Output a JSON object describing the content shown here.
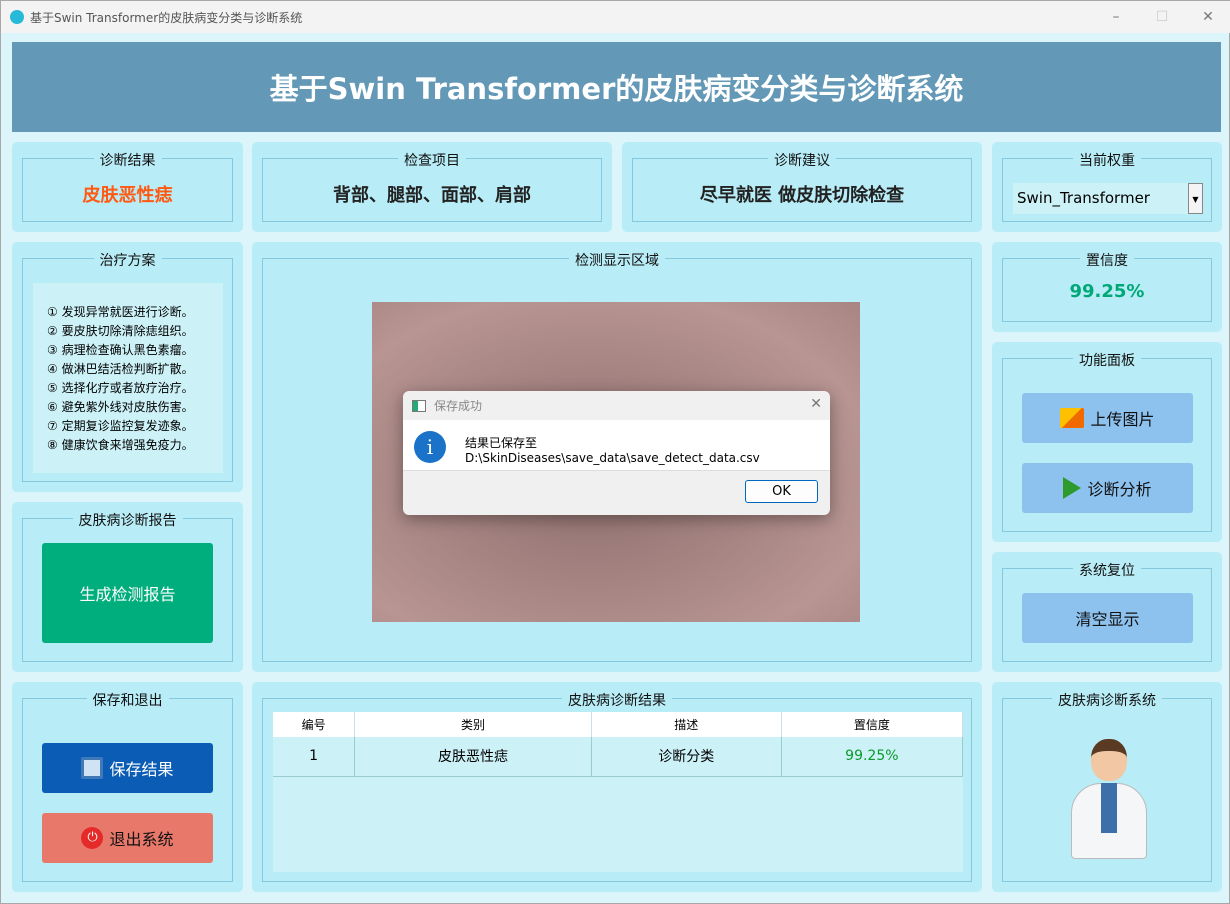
{
  "window": {
    "title": "基于Swin Transformer的皮肤病变分类与诊断系统",
    "minimize": "–",
    "maximize": "☐",
    "close": "✕"
  },
  "banner": "基于Swin Transformer的皮肤病变分类与诊断系统",
  "result": {
    "title": "诊断结果",
    "value": "皮肤恶性痣",
    "color": "#ff5a14"
  },
  "items": {
    "title": "检查项目",
    "value": "背部、腿部、面部、肩部"
  },
  "advice": {
    "title": "诊断建议",
    "value": "尽早就医 做皮肤切除检查"
  },
  "weight": {
    "title": "当前权重",
    "selected": "Swin_Transformer"
  },
  "treatment": {
    "title": "治疗方案",
    "lines": [
      "① 发现异常就医进行诊断。",
      "② 要皮肤切除清除痣组织。",
      "③ 病理检查确认黑色素瘤。",
      "④ 做淋巴结活检判断扩散。",
      "⑤ 选择化疗或者放疗治疗。",
      "⑥ 避免紫外线对皮肤伤害。",
      "⑦ 定期复诊监控复发迹象。",
      "⑧ 健康饮食来增强免疫力。"
    ]
  },
  "detect": {
    "title": "检测显示区域"
  },
  "confidence": {
    "title": "置信度",
    "value": "99.25%",
    "color": "#00a878"
  },
  "functions": {
    "title": "功能面板",
    "upload": "上传图片",
    "analyze": "诊断分析"
  },
  "reset": {
    "title": "系统复位",
    "clear": "清空显示"
  },
  "report": {
    "title": "皮肤病诊断报告",
    "generate": "生成检测报告"
  },
  "save_exit": {
    "title": "保存和退出",
    "save": "保存结果",
    "exit": "退出系统"
  },
  "table": {
    "title": "皮肤病诊断结果",
    "headers": [
      "编号",
      "类别",
      "描述",
      "置信度"
    ],
    "rows": [
      [
        "1",
        "皮肤恶性痣",
        "诊断分类",
        "99.25%"
      ]
    ]
  },
  "system": {
    "title": "皮肤病诊断系统"
  },
  "dialog": {
    "title": "保存成功",
    "message": "结果已保存至 D:\\SkinDiseases\\save_data\\save_detect_data.csv",
    "ok": "OK"
  }
}
